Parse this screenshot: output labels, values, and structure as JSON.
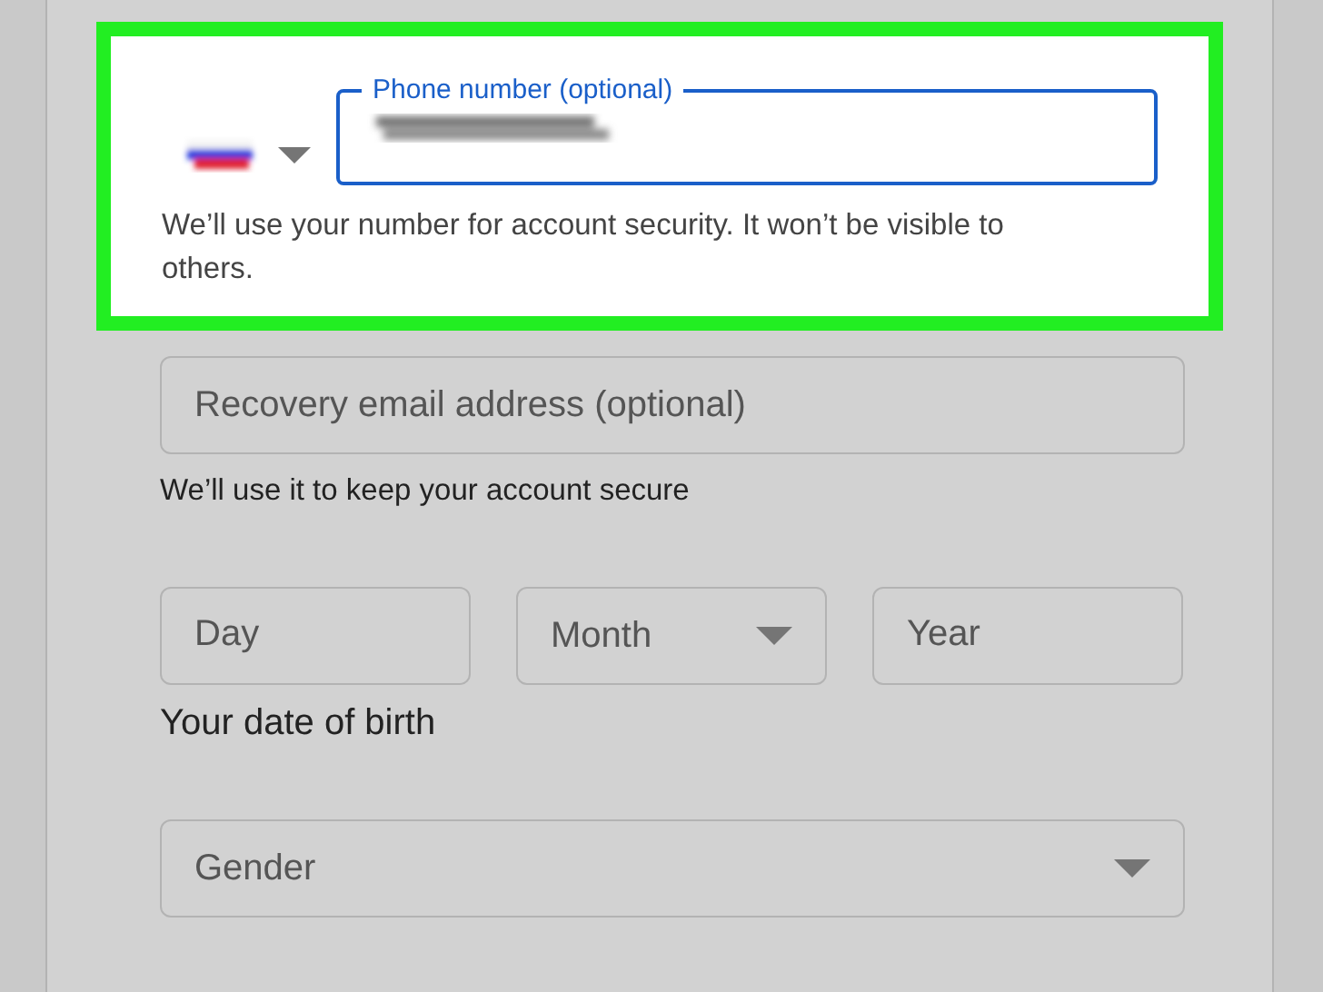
{
  "phone": {
    "label": "Phone number (optional)",
    "hint": "We’ll use your number for account security. It won’t be visible to others.",
    "highlighted": true
  },
  "recovery_email": {
    "placeholder": "Recovery email address (optional)",
    "hint": "We’ll use it to keep your account secure"
  },
  "birth_date": {
    "fields": [
      {
        "placeholder": "Day",
        "kind": "text"
      },
      {
        "placeholder": "Month",
        "kind": "dropdown"
      },
      {
        "placeholder": "Year",
        "kind": "text"
      }
    ],
    "caption": "Your date of birth"
  },
  "gender": {
    "placeholder": "Gender"
  }
}
